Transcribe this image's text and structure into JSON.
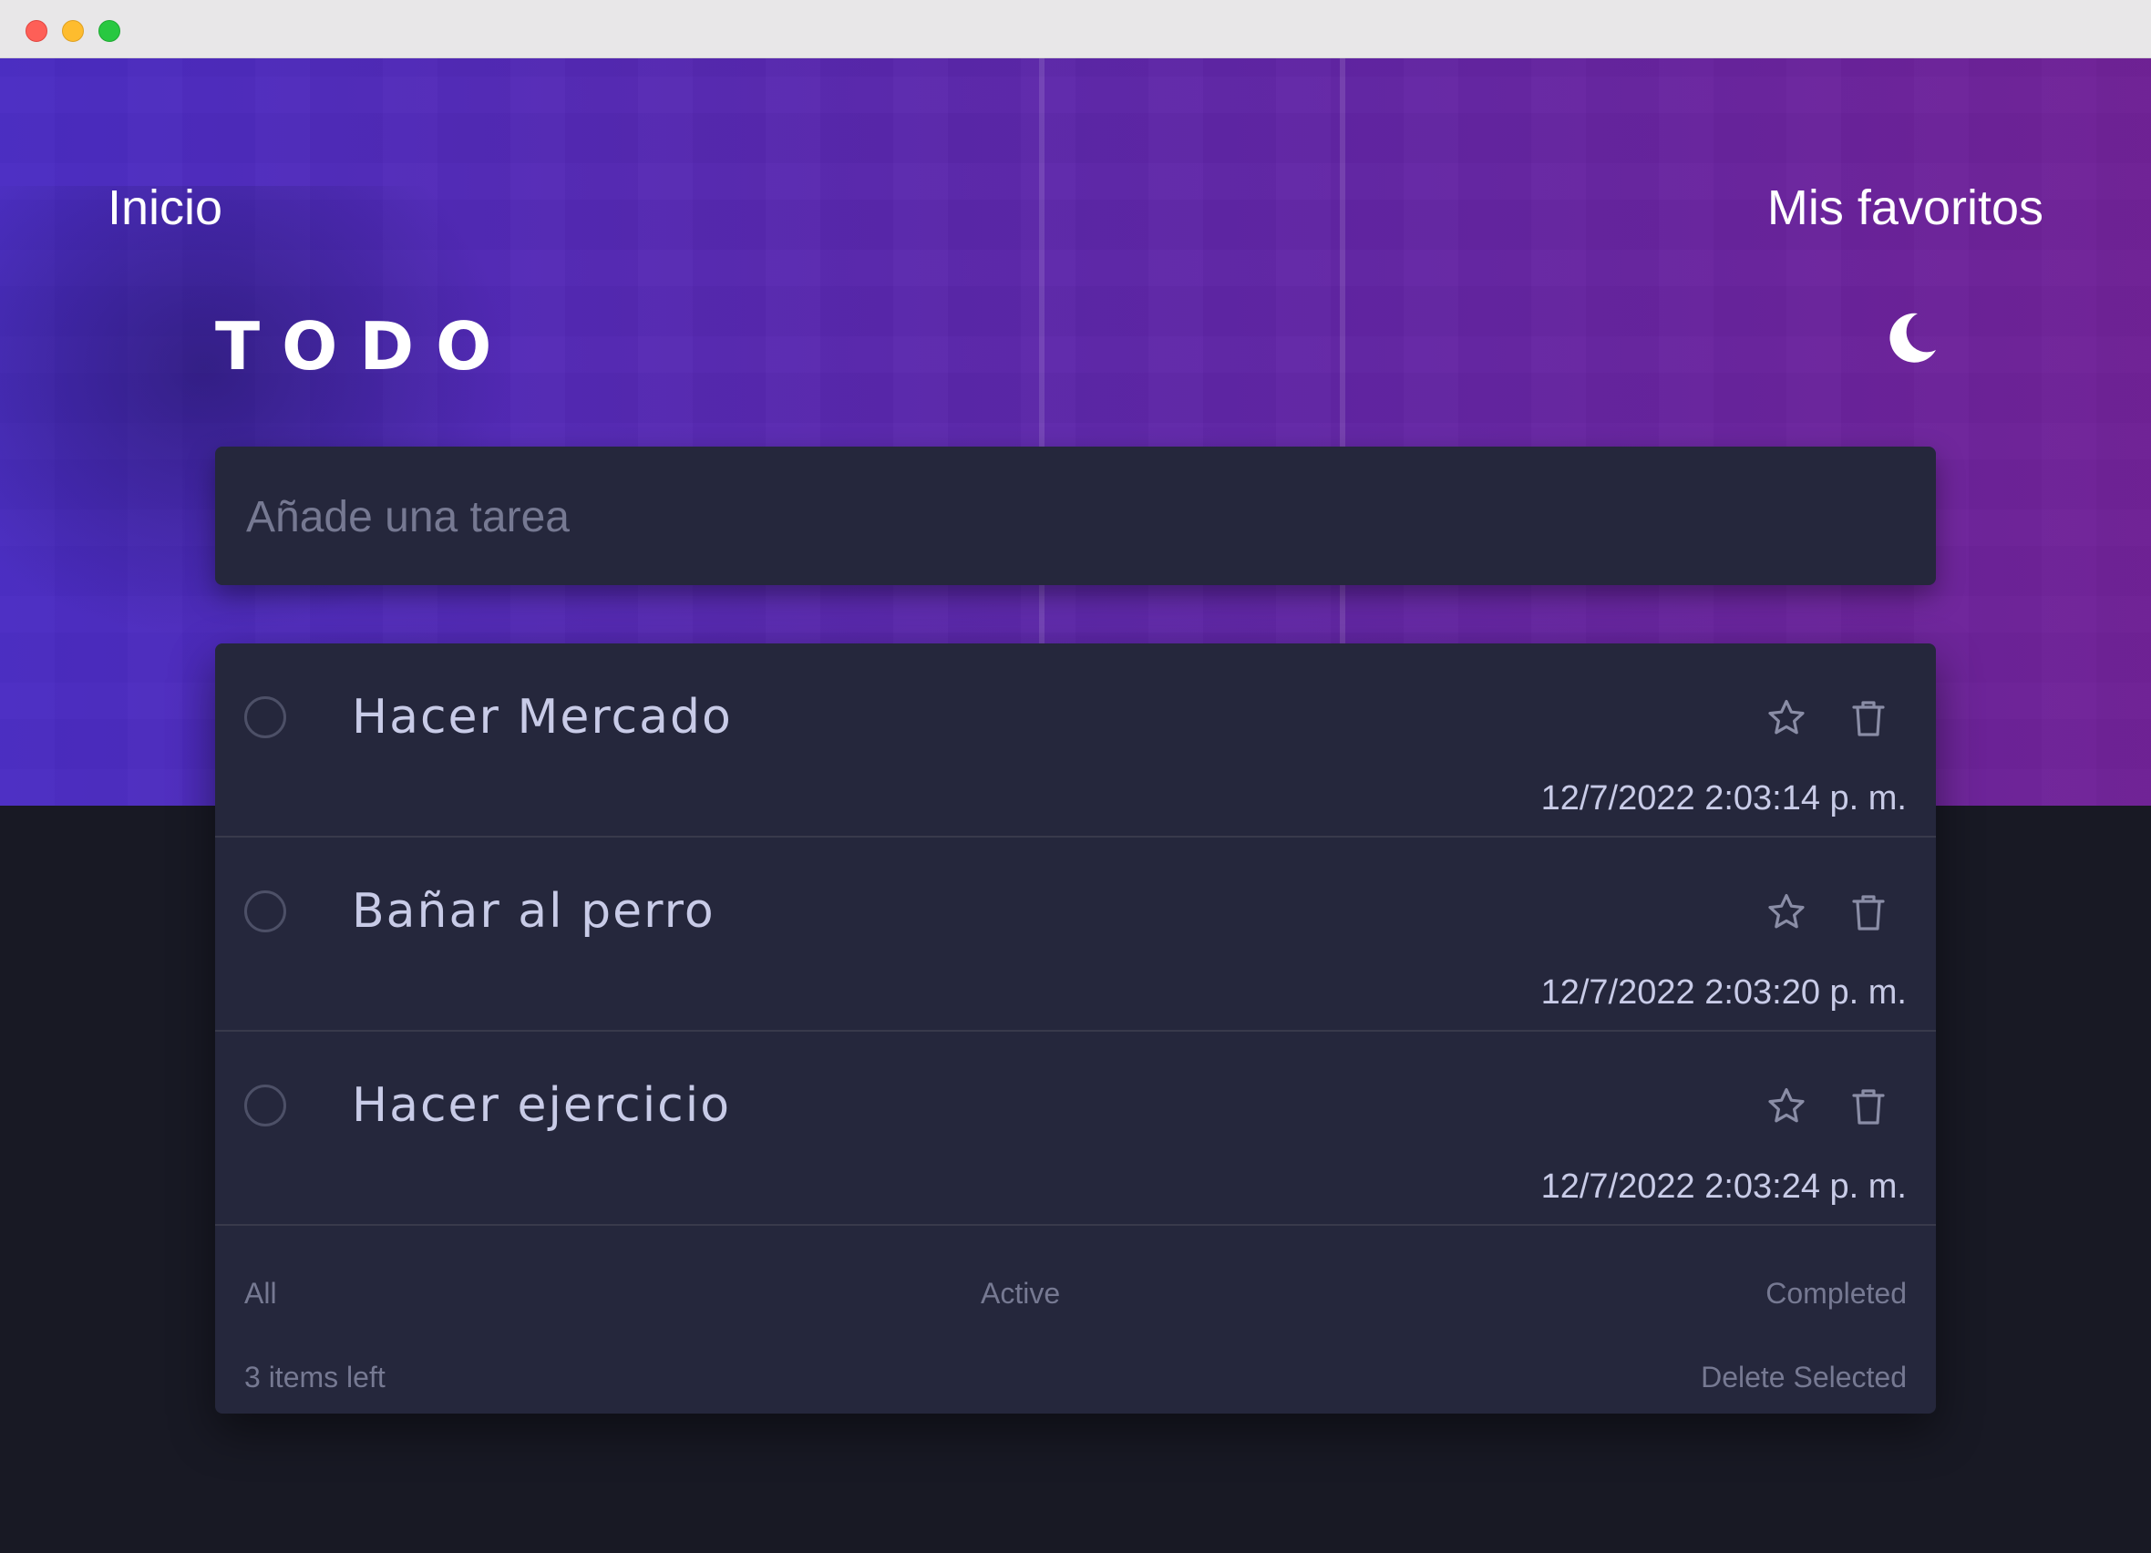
{
  "nav": {
    "home_label": "Inicio",
    "favorites_label": "Mis favoritos"
  },
  "header": {
    "title": "TODO",
    "theme_icon": "moon-icon"
  },
  "new_task": {
    "placeholder": "Añade una tarea",
    "value": ""
  },
  "tasks": [
    {
      "title": "Hacer Mercado",
      "date": "12/7/2022 2:03:14 p. m.",
      "completed": false,
      "favorite": false
    },
    {
      "title": "Bañar al perro",
      "date": "12/7/2022 2:03:20 p. m.",
      "completed": false,
      "favorite": false
    },
    {
      "title": "Hacer ejercicio",
      "date": "12/7/2022 2:03:24 p. m.",
      "completed": false,
      "favorite": false
    }
  ],
  "footer": {
    "filters": [
      "All",
      "Active",
      "Completed"
    ],
    "items_left": "3 items left",
    "delete_selected": "Delete Selected"
  },
  "colors": {
    "background": "#181924",
    "card": "#25273c",
    "text": "#c8cbe7",
    "muted": "#767992",
    "hero_start": "#4a2dcd",
    "hero_end": "#7a2096"
  }
}
